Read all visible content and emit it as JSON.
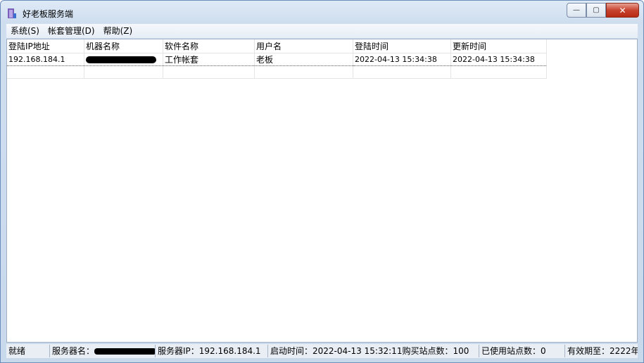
{
  "window": {
    "title": "好老板服务端",
    "minimize_glyph": "—",
    "maximize_glyph": "▢",
    "close_glyph": "✕"
  },
  "menu": {
    "items": [
      {
        "label": "系统(S)"
      },
      {
        "label": "帐套管理(D)"
      },
      {
        "label": "帮助(Z)"
      }
    ]
  },
  "table": {
    "columns": [
      "登陆IP地址",
      "机器名称",
      "软件名称",
      "用户名",
      "登陆时间",
      "更新时间"
    ],
    "rows": [
      {
        "ip": "192.168.184.1",
        "machine": "",
        "software": "工作帐套",
        "user": "老板",
        "login": "2022-04-13 15:34:38",
        "update": "2022-04-13 15:34:38"
      }
    ]
  },
  "status": {
    "ready": "就绪",
    "server_name_label": "服务器名：",
    "server_ip": "服务器IP：192.168.184.1",
    "start_time": "启动时间：2022-04-13 15:32:11",
    "purchased": "购买站点数：100",
    "used": "已使用站点数：0",
    "expiry": "有效期至：2222年"
  },
  "colors": {
    "accent": "#6c8dbb",
    "close": "#c7432f"
  }
}
